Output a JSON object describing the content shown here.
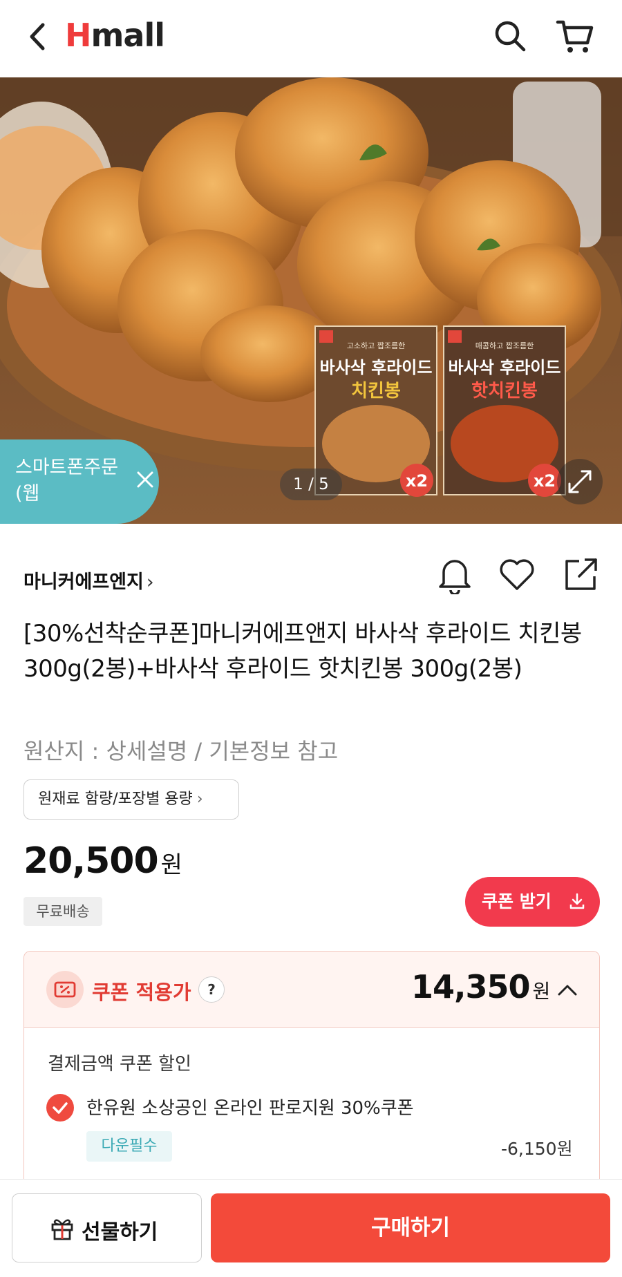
{
  "header": {
    "logo_text": "Hmall",
    "logo_first_letter": "H",
    "logo_rest": "mall",
    "brand_color": "#ef3b3b"
  },
  "hero": {
    "smart_badge_line1": "스마트폰주문",
    "smart_badge_line2": "(웹",
    "pager": "1 / 5",
    "pack1": {
      "top_small": "고소하고 짭조름한",
      "name_line1": "바사삭 후라이드",
      "name_line2": "치킨봉",
      "multiplier": "x2"
    },
    "pack2": {
      "top_small": "매콤하고 짭조름한",
      "name_line1": "바사삭 후라이드",
      "name_line2": "핫치킨봉",
      "multiplier": "x2"
    }
  },
  "product": {
    "brand": "마니커에프엔지",
    "title": "[30%선착순쿠폰]마니커에프앤지 바사삭 후라이드 치킨봉 300g(2봉)+바사삭 후라이드 핫치킨봉 300g(2봉)",
    "origin": "원산지 : 상세설명 / 기본정보 참고",
    "ingredient_button": "원재료 함량/포장별 용량",
    "price": "20,500",
    "price_unit": "원",
    "free_shipping": "무료배송",
    "coupon_button": "쿠폰 받기"
  },
  "coupon": {
    "label": "쿠폰 적용가",
    "question": "?",
    "price": "14,350",
    "price_unit": "원",
    "discount_title": "결제금액 쿠폰 할인",
    "discount_item": "한유원 소상공인 온라인 판로지원 30%쿠폰",
    "download_tag": "다운필수",
    "discount_amount": "-6,150원",
    "accent_color": "#e13b33"
  },
  "bottom": {
    "gift_label": "선물하기",
    "buy_label": "구매하기",
    "buy_color": "#f34a3a"
  }
}
